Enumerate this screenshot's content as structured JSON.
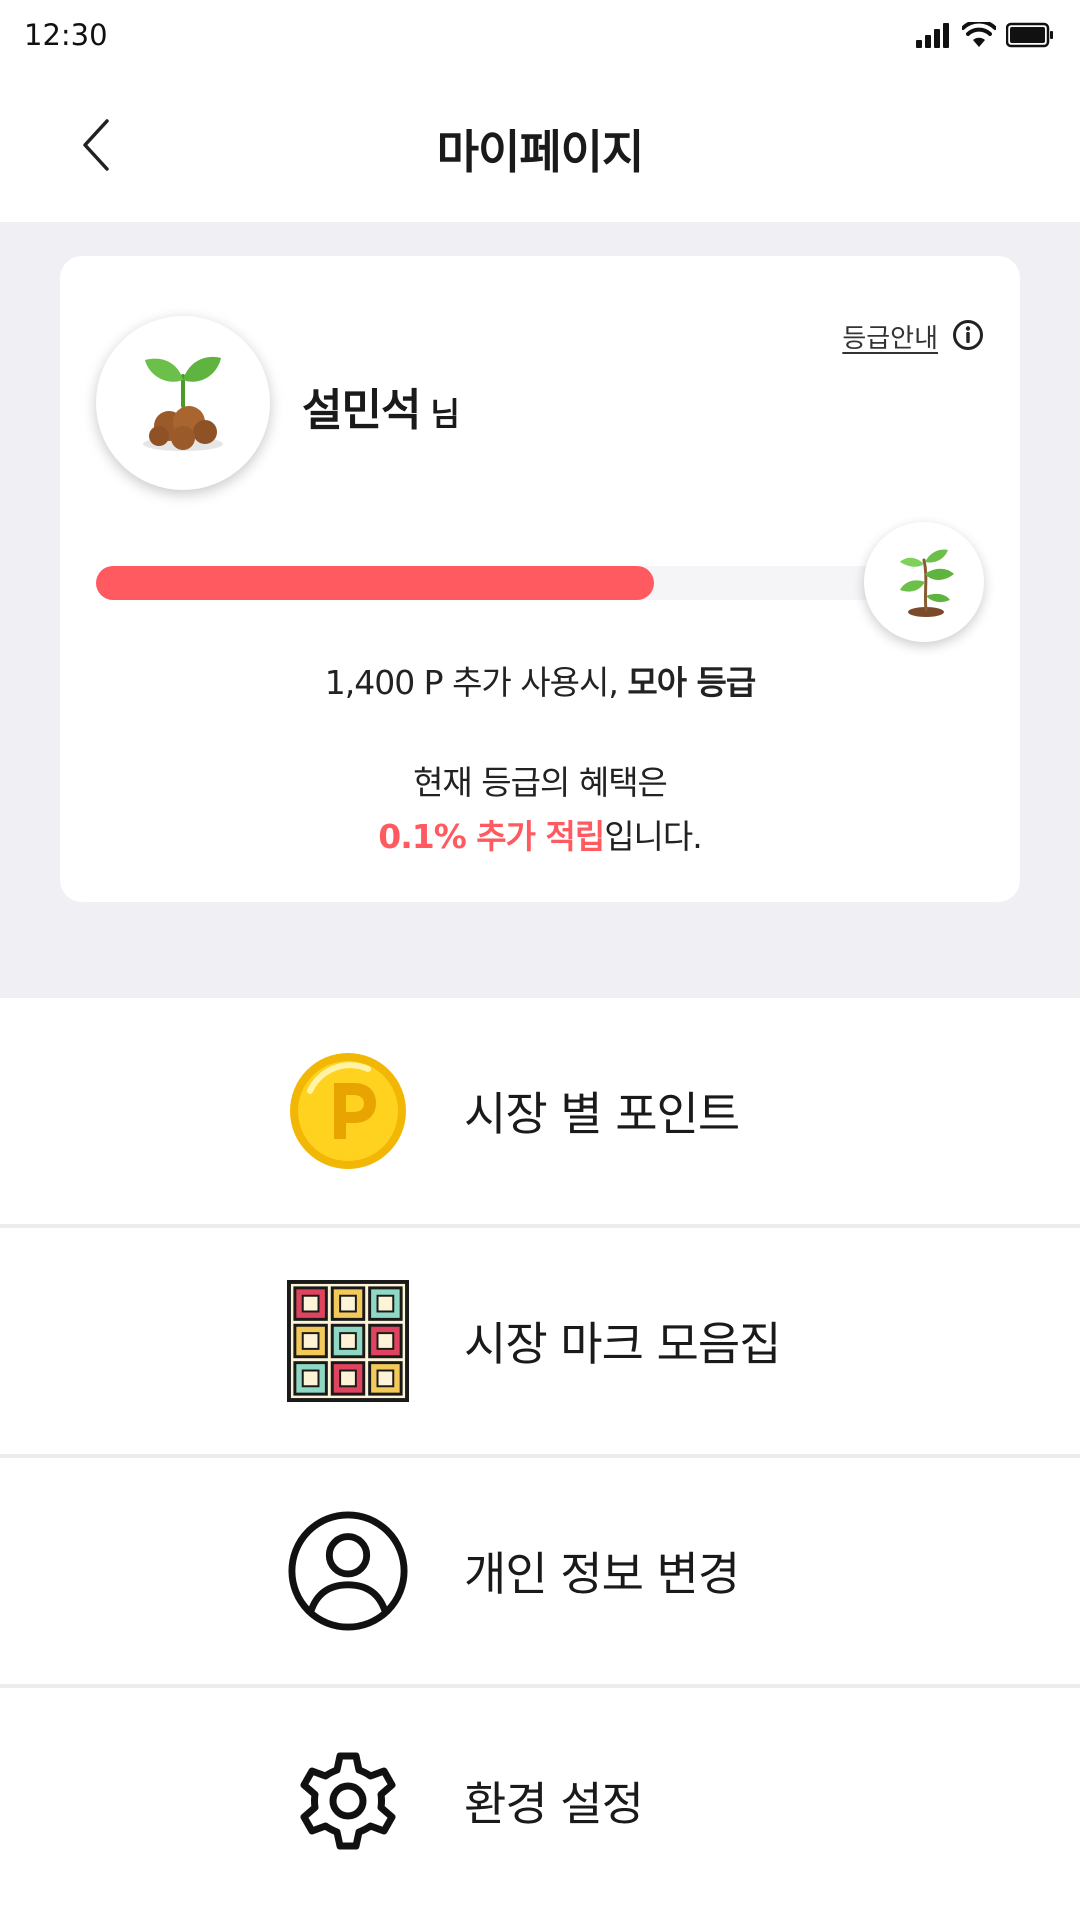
{
  "status_bar": {
    "time": "12:30",
    "icons": [
      "signal-icon",
      "wifi-icon",
      "battery-icon"
    ]
  },
  "header": {
    "title": "마이페이지",
    "back_icon": "chevron-left-icon"
  },
  "grade_card": {
    "user_name": "설민석",
    "user_suffix": "님",
    "grade_guide_label": "등급안내",
    "grade_guide_icon": "info-icon",
    "progress": 0.68,
    "progress_color": "#ff5a5f",
    "next_grade_prefix": "1,400 P 추가 사용시, ",
    "next_grade_name": "모아 등급",
    "benefit_line1": "현재 등급의 혜택은",
    "benefit_highlight": "0.1% 추가 적립",
    "benefit_suffix": "입니다."
  },
  "menu": {
    "items": [
      {
        "label": "시장 별 포인트",
        "icon": "point-coin-icon"
      },
      {
        "label": "시장 마크 모음집",
        "icon": "stamp-grid-icon"
      },
      {
        "label": "개인 정보 변경",
        "icon": "user-profile-icon"
      },
      {
        "label": "환경 설정",
        "icon": "gear-icon"
      }
    ]
  },
  "colors": {
    "accent": "#ff5a5f",
    "background_grey": "#efeff4"
  }
}
